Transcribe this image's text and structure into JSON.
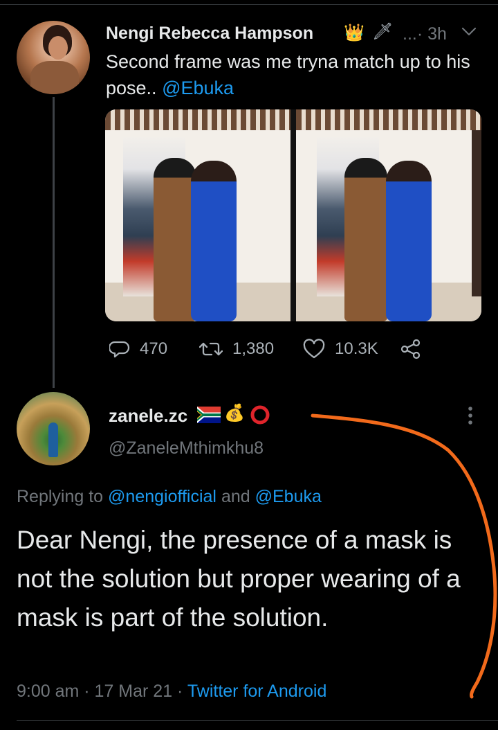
{
  "parent_tweet": {
    "author_name": "Nengi Rebecca Hampson",
    "emoji_1": "👑",
    "emoji_2": "🗡",
    "time": "...· 3h",
    "text_part_1": "Second frame was me tryna match up to his pose.. ",
    "mention": "@Ebuka",
    "stats": {
      "replies": "470",
      "retweets": "1,380",
      "likes": "10.3K"
    }
  },
  "reply_tweet": {
    "author_name": "zanele.zc",
    "flag_icon": "south-africa-flag-icon",
    "emoji_money": "💰",
    "handle": "@ZaneleMthimkhu8",
    "replying_prefix": "Replying to ",
    "replying_mention_1": "@nengiofficial",
    "replying_and": " and ",
    "replying_mention_2": "@Ebuka",
    "text": "Dear Nengi, the presence of a mask is not the solution but proper wearing of a mask is part of the solution.",
    "timestamp": "9:00 am · 17 Mar 21 · ",
    "client": "Twitter for Android"
  },
  "colors": {
    "background": "#000000",
    "text": "#e7e9ea",
    "muted": "#71767b",
    "link": "#1d9bf0",
    "annotation": "#f26a1b"
  }
}
